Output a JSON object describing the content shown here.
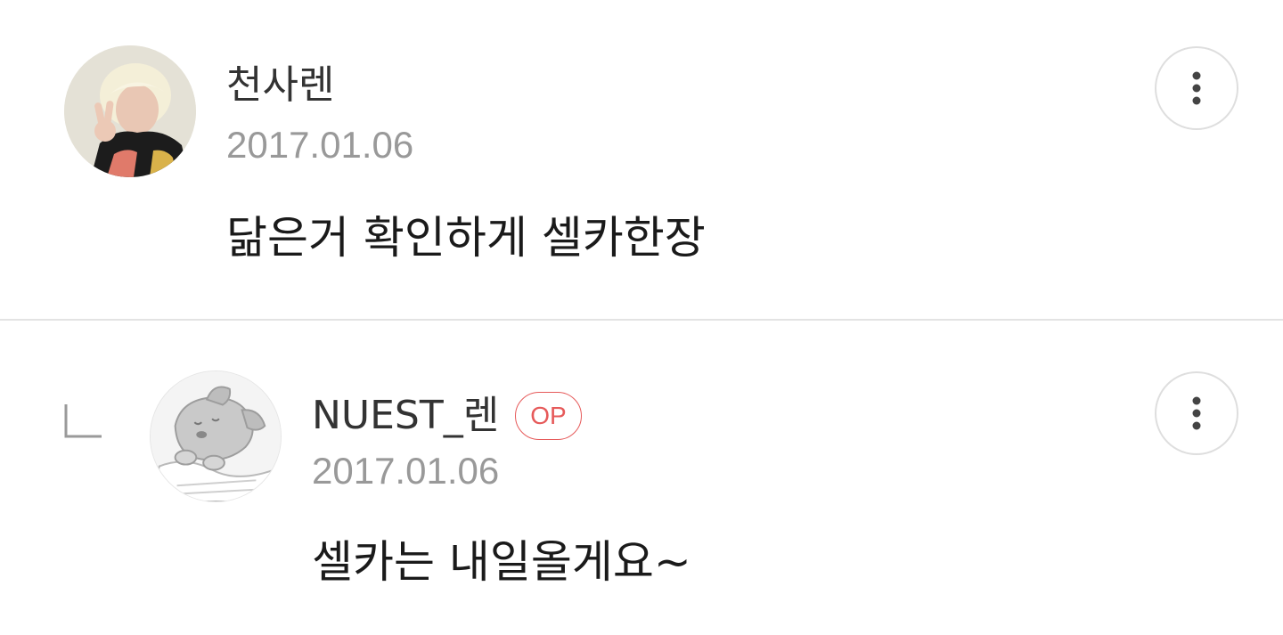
{
  "comments": [
    {
      "author": "천사렌",
      "date": "2017.01.06",
      "text": "닮은거 확인하게 셀카한장",
      "avatar_icon": "profile-photo",
      "more_icon": "more-vertical-icon"
    },
    {
      "author": "NUEST_렌",
      "badge": "OP",
      "date": "2017.01.06",
      "text": "셀카는 내일올게요~",
      "avatar_icon": "sleeping-dog-illustration",
      "reply_icon": "reply-indicator-icon",
      "more_icon": "more-vertical-icon"
    }
  ],
  "colors": {
    "badge": "#e65a5a",
    "date": "#999999",
    "name": "#333333",
    "divider": "#e3e3e3"
  }
}
